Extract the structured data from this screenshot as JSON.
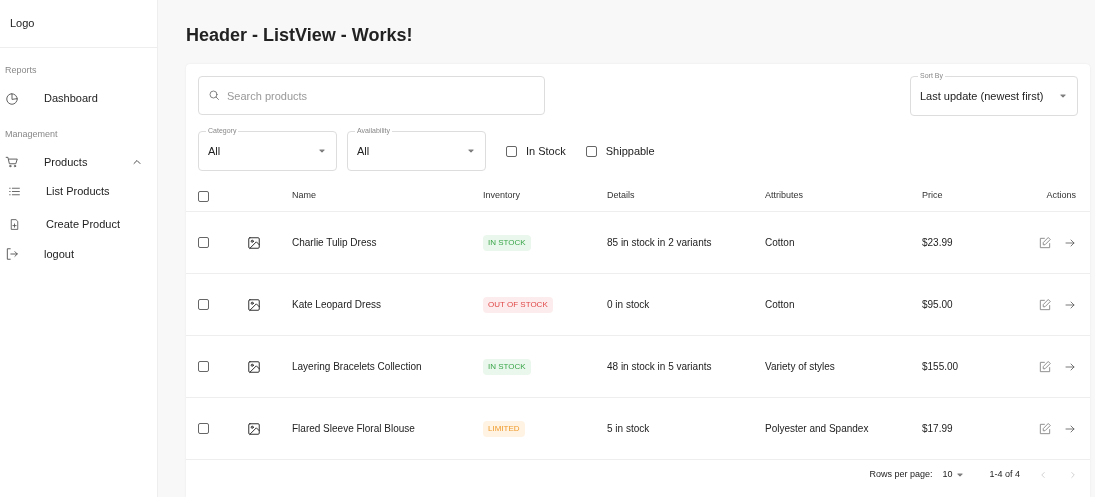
{
  "sidebar": {
    "logo": "Logo",
    "sections": [
      {
        "label": "Reports",
        "items": [
          {
            "label": "Dashboard"
          }
        ]
      },
      {
        "label": "Management",
        "items": [
          {
            "label": "Products",
            "expanded": true,
            "children": [
              {
                "label": "List Products"
              },
              {
                "label": "Create Product"
              }
            ]
          },
          {
            "label": "logout"
          }
        ]
      }
    ]
  },
  "header": {
    "title": "Header - ListView - Works!"
  },
  "filters": {
    "search": {
      "placeholder": "Search products"
    },
    "sort": {
      "label": "Sort By",
      "value": "Last update (newest first)"
    },
    "selects": [
      {
        "label": "Category",
        "value": "All"
      },
      {
        "label": "Availability",
        "value": "All"
      }
    ],
    "checkboxes": [
      {
        "label": "In Stock",
        "checked": false
      },
      {
        "label": "Shippable",
        "checked": false
      }
    ]
  },
  "table": {
    "select_all": {
      "checked": false
    },
    "columns": [
      "Name",
      "Inventory",
      "Details",
      "Attributes",
      "Price",
      "Actions"
    ],
    "rows": [
      {
        "checked": false,
        "name": "Charlie Tulip Dress",
        "inventory": {
          "label": "IN STOCK",
          "kind": "in_stock"
        },
        "details": "85 in stock in 2 variants",
        "attributes": "Cotton",
        "price": "$23.99"
      },
      {
        "checked": false,
        "name": "Kate Leopard Dress",
        "inventory": {
          "label": "OUT OF STOCK",
          "kind": "out_of_stock"
        },
        "details": "0 in stock",
        "attributes": "Cotton",
        "price": "$95.00"
      },
      {
        "checked": false,
        "name": "Layering Bracelets Collection",
        "inventory": {
          "label": "IN STOCK",
          "kind": "in_stock"
        },
        "details": "48 in stock in 5 variants",
        "attributes": "Variety of styles",
        "price": "$155.00"
      },
      {
        "checked": false,
        "name": "Flared Sleeve Floral Blouse",
        "inventory": {
          "label": "LIMITED",
          "kind": "limited"
        },
        "details": "5 in stock",
        "attributes": "Polyester and Spandex",
        "price": "$17.99"
      }
    ]
  },
  "pagination": {
    "rows_per_page_label": "Rows per page:",
    "rows_per_page": "10",
    "range": "1-4 of 4"
  }
}
